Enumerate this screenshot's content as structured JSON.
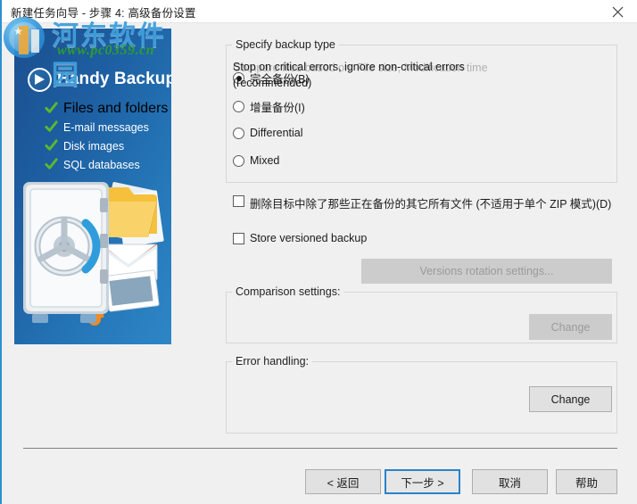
{
  "window": {
    "title": "新建任务向导 - 步骤 4: 高级备份设置",
    "close_icon": "close-icon"
  },
  "watermark": {
    "site_name": "河东软件园",
    "site_url": "www.pc0359.cn",
    "brand_color": "#3f9fdb",
    "url_color": "#2ea02e"
  },
  "sidebar": {
    "product_name": "Handy Backup",
    "accent_color": "#1b5ca0",
    "check_color": "#5cb82e",
    "features": [
      {
        "label": "Files and folders"
      },
      {
        "label": "E-mail messages"
      },
      {
        "label": "Disk images"
      },
      {
        "label": "SQL databases"
      }
    ]
  },
  "main": {
    "backup_type": {
      "legend": "Specify backup type",
      "options": [
        {
          "label": "完全备份(B)",
          "checked": true
        },
        {
          "label": "增量备份(I)",
          "checked": false
        },
        {
          "label": "Differential",
          "checked": false
        },
        {
          "label": "Mixed",
          "checked": false
        }
      ]
    },
    "checkboxes": [
      {
        "label": "删除目标中除了那些正在备份的其它所有文件 (不适用于单个 ZIP 模式)(D)",
        "checked": false
      },
      {
        "label": "Store versioned backup",
        "checked": false
      }
    ],
    "versions_rotation_button": {
      "label": "Versions rotation settings...",
      "enabled": false
    },
    "comparison": {
      "legend": "Comparison settings:",
      "text": "Compare files based on: File size, Modification time",
      "change_label": "Change",
      "change_enabled": false
    },
    "error_handling": {
      "legend": "Error handling:",
      "text": "Stop on critical errors, ignore non-critical errors (recommended)",
      "change_label": "Change",
      "change_enabled": true
    }
  },
  "footer": {
    "back_label": "< 返回",
    "next_label": "下一步 >",
    "cancel_label": "取消",
    "help_label": "帮助",
    "focus_color": "#2b83c8"
  }
}
